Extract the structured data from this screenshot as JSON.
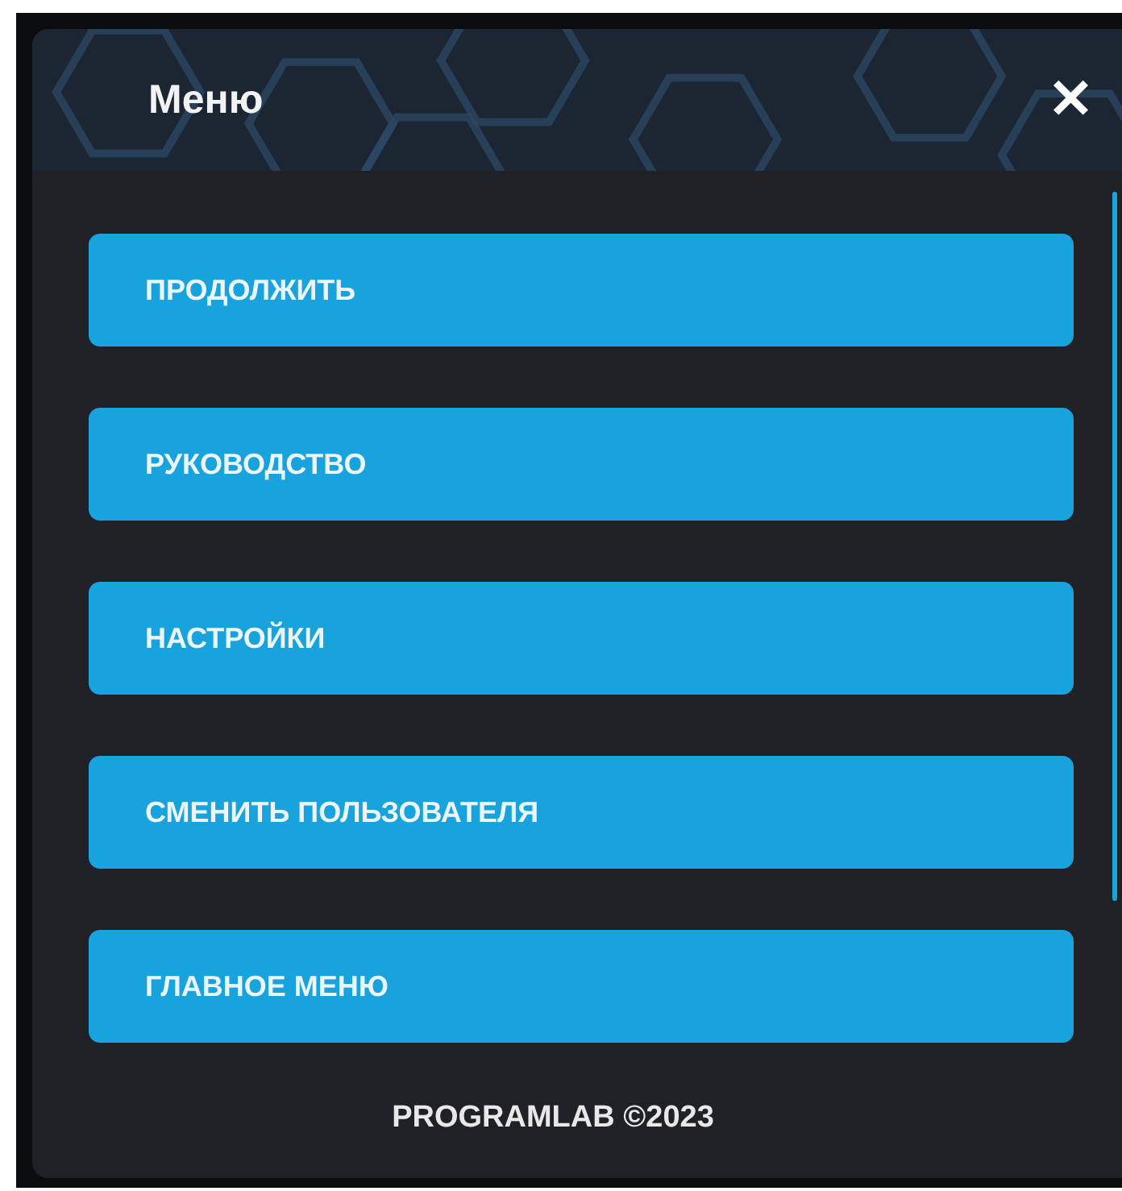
{
  "header": {
    "title": "Меню",
    "close": "✕"
  },
  "menu_items": [
    {
      "label": "ПРОДОЛЖИТЬ"
    },
    {
      "label": "РУКОВОДСТВО"
    },
    {
      "label": "НАСТРОЙКИ"
    },
    {
      "label": "СМЕНИТЬ ПОЛЬЗОВАТЕЛЯ"
    },
    {
      "label": "ГЛАВНОЕ МЕНЮ"
    }
  ],
  "footer": "PROGRAMLAB ©2023"
}
